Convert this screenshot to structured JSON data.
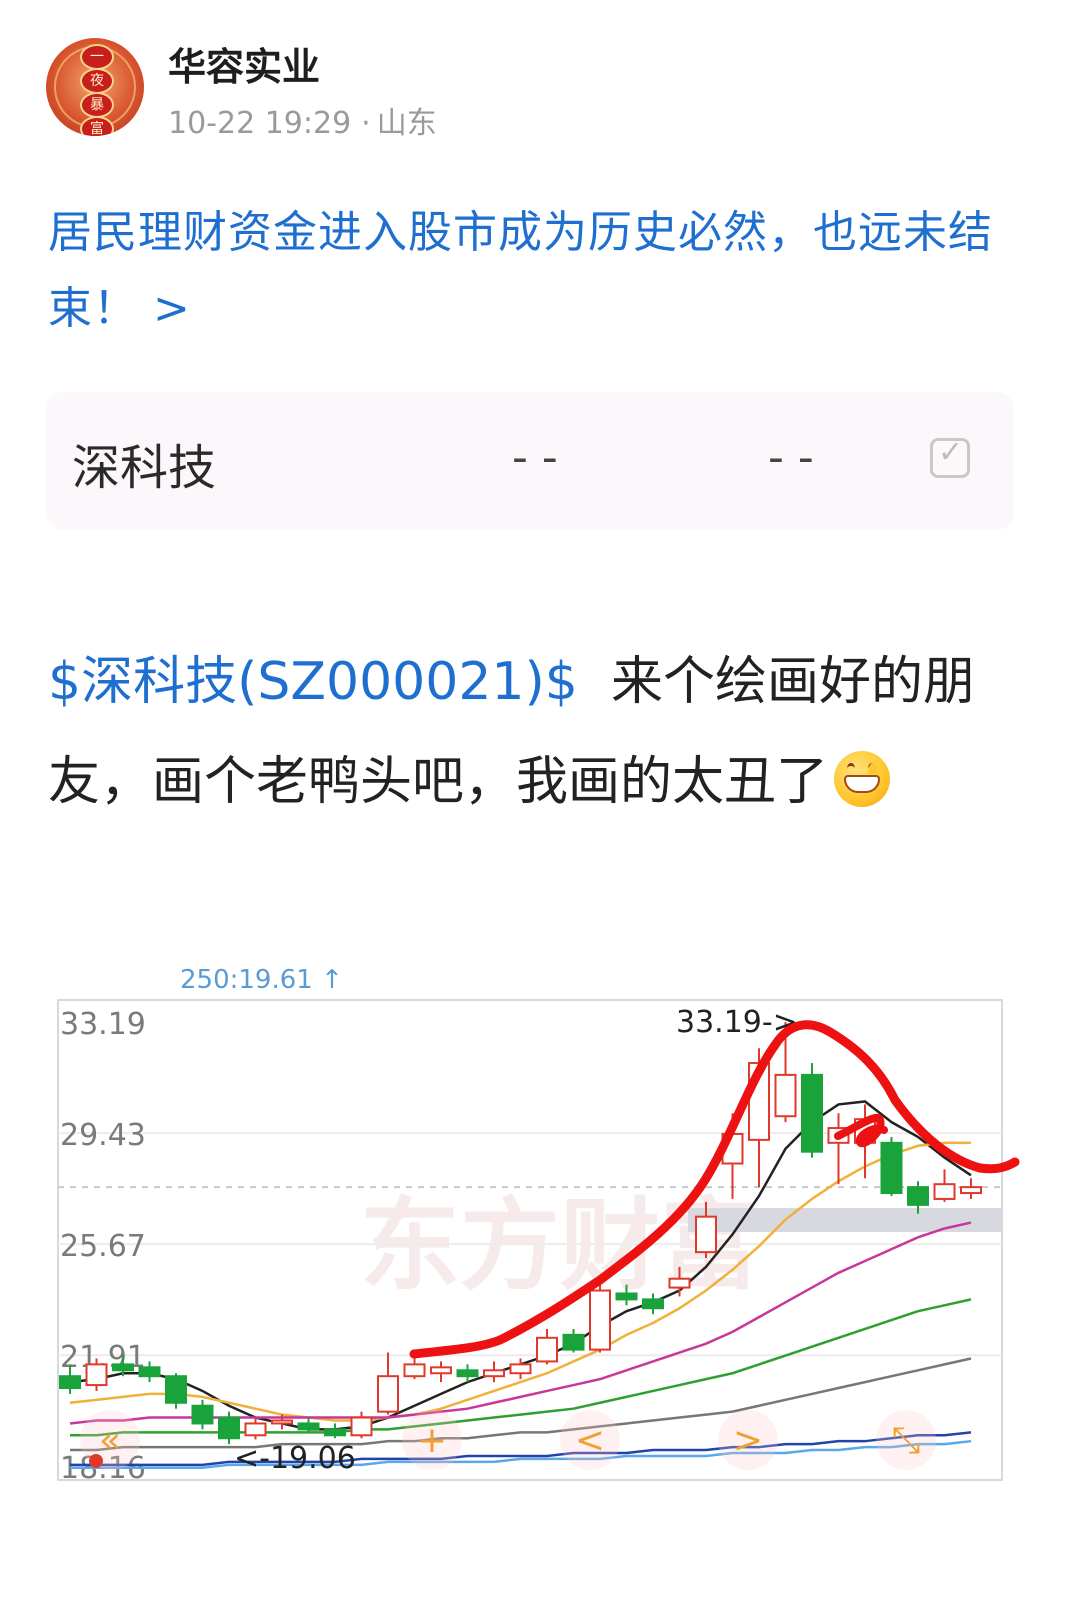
{
  "author": {
    "avatar_chars": [
      "一",
      "夜",
      "暴",
      "富"
    ],
    "name": "华容实业",
    "time": "10-22 19:29",
    "separator": "·",
    "location": "山东"
  },
  "headline": {
    "text": "居民理财资金进入股市成为历史必然，也远未结束！",
    "arrow": ">"
  },
  "stock_card": {
    "name": "深科技",
    "price": "--",
    "change": "--",
    "checkbox_icon": "check-icon"
  },
  "post": {
    "tag": "$深科技(SZ000021)$",
    "text": "来个绘画好的朋友，画个老鸭头吧，我画的太丑了",
    "emoji": "grinning-face-icon"
  },
  "chart": {
    "top_label": "250:19.61 ↑",
    "watermark": "东方财富",
    "high_label": "33.19->",
    "low_label": "<-19.06",
    "controls": [
      {
        "name": "rewind-icon",
        "glyph": "«"
      },
      {
        "name": "crosshair-icon",
        "glyph": "+"
      },
      {
        "name": "prev-icon",
        "glyph": "<"
      },
      {
        "name": "next-icon",
        "glyph": ">"
      },
      {
        "name": "expand-icon",
        "glyph": "⤡"
      }
    ],
    "colors": {
      "up": "#e0392b",
      "down": "#1aa33a",
      "annotation": "#ee1111"
    }
  },
  "chart_data": {
    "type": "candlestick",
    "y_ticks": [
      "33.19",
      "29.43",
      "25.67",
      "21.91",
      "18.16"
    ],
    "ylim": [
      18.16,
      33.19
    ],
    "grid": true,
    "candles": [
      {
        "o": 21.2,
        "c": 20.8,
        "h": 21.6,
        "l": 20.6
      },
      {
        "o": 20.9,
        "c": 21.6,
        "h": 21.8,
        "l": 20.7
      },
      {
        "o": 21.6,
        "c": 21.4,
        "h": 21.9,
        "l": 21.2
      },
      {
        "o": 21.5,
        "c": 21.2,
        "h": 21.7,
        "l": 21.0
      },
      {
        "o": 21.2,
        "c": 20.3,
        "h": 21.3,
        "l": 20.1
      },
      {
        "o": 20.2,
        "c": 19.6,
        "h": 20.4,
        "l": 19.4
      },
      {
        "o": 19.8,
        "c": 19.1,
        "h": 20.0,
        "l": 18.9
      },
      {
        "o": 19.2,
        "c": 19.6,
        "h": 19.8,
        "l": 19.06
      },
      {
        "o": 19.6,
        "c": 19.7,
        "h": 19.9,
        "l": 19.4
      },
      {
        "o": 19.6,
        "c": 19.4,
        "h": 19.8,
        "l": 19.3
      },
      {
        "o": 19.4,
        "c": 19.2,
        "h": 19.6,
        "l": 19.1
      },
      {
        "o": 19.2,
        "c": 19.8,
        "h": 20.0,
        "l": 19.1
      },
      {
        "o": 20.0,
        "c": 21.2,
        "h": 22.0,
        "l": 19.9
      },
      {
        "o": 21.2,
        "c": 21.6,
        "h": 21.9,
        "l": 21.1
      },
      {
        "o": 21.3,
        "c": 21.5,
        "h": 21.7,
        "l": 21.0
      },
      {
        "o": 21.4,
        "c": 21.2,
        "h": 21.6,
        "l": 21.0
      },
      {
        "o": 21.2,
        "c": 21.4,
        "h": 21.7,
        "l": 21.0
      },
      {
        "o": 21.3,
        "c": 21.6,
        "h": 21.8,
        "l": 21.1
      },
      {
        "o": 21.7,
        "c": 22.5,
        "h": 22.8,
        "l": 21.6
      },
      {
        "o": 22.6,
        "c": 22.1,
        "h": 22.8,
        "l": 22.0
      },
      {
        "o": 22.1,
        "c": 24.1,
        "h": 24.3,
        "l": 22.0
      },
      {
        "o": 24.0,
        "c": 23.8,
        "h": 24.3,
        "l": 23.6
      },
      {
        "o": 23.8,
        "c": 23.5,
        "h": 24.0,
        "l": 23.3
      },
      {
        "o": 24.2,
        "c": 24.5,
        "h": 24.9,
        "l": 23.9
      },
      {
        "o": 25.4,
        "c": 26.6,
        "h": 27.1,
        "l": 25.2
      },
      {
        "o": 28.4,
        "c": 29.4,
        "h": 30.1,
        "l": 27.2
      },
      {
        "o": 29.2,
        "c": 31.8,
        "h": 32.3,
        "l": 27.6
      },
      {
        "o": 30.0,
        "c": 31.4,
        "h": 33.19,
        "l": 29.8
      },
      {
        "o": 31.4,
        "c": 28.8,
        "h": 31.8,
        "l": 28.6
      },
      {
        "o": 29.1,
        "c": 29.6,
        "h": 30.1,
        "l": 27.7
      },
      {
        "o": 29.1,
        "c": 29.9,
        "h": 30.4,
        "l": 27.9
      },
      {
        "o": 29.1,
        "c": 27.4,
        "h": 29.3,
        "l": 27.3
      },
      {
        "o": 27.6,
        "c": 27.0,
        "h": 27.8,
        "l": 26.7
      },
      {
        "o": 27.2,
        "c": 27.7,
        "h": 28.2,
        "l": 27.1
      },
      {
        "o": 27.4,
        "c": 27.6,
        "h": 27.9,
        "l": 27.2
      }
    ],
    "ma_series": [
      {
        "color": "#222222",
        "values": [
          21.0,
          21.1,
          21.3,
          21.3,
          21.1,
          20.7,
          20.2,
          19.8,
          19.6,
          19.4,
          19.4,
          19.5,
          19.8,
          20.2,
          20.6,
          21.0,
          21.3,
          21.6,
          21.9,
          22.3,
          22.9,
          23.4,
          23.7,
          24.1,
          24.9,
          26.0,
          27.3,
          28.9,
          29.8,
          30.4,
          30.5,
          29.8,
          29.3,
          28.6,
          28.0
        ]
      },
      {
        "color": "#f0b13a",
        "values": [
          20.3,
          20.4,
          20.5,
          20.6,
          20.6,
          20.5,
          20.3,
          20.1,
          19.9,
          19.8,
          19.7,
          19.7,
          19.8,
          19.9,
          20.1,
          20.4,
          20.7,
          21.0,
          21.3,
          21.7,
          22.1,
          22.6,
          23.0,
          23.5,
          24.1,
          24.8,
          25.6,
          26.5,
          27.2,
          27.8,
          28.3,
          28.7,
          29.0,
          29.1,
          29.1
        ]
      },
      {
        "color": "#c8379a",
        "values": [
          19.6,
          19.7,
          19.7,
          19.8,
          19.8,
          19.8,
          19.8,
          19.8,
          19.8,
          19.8,
          19.8,
          19.8,
          19.8,
          19.9,
          20.0,
          20.1,
          20.3,
          20.5,
          20.7,
          20.9,
          21.1,
          21.4,
          21.7,
          22.0,
          22.3,
          22.7,
          23.2,
          23.7,
          24.2,
          24.7,
          25.1,
          25.5,
          25.9,
          26.2,
          26.4
        ]
      },
      {
        "color": "#2ea02e",
        "values": [
          19.2,
          19.2,
          19.3,
          19.3,
          19.3,
          19.3,
          19.3,
          19.3,
          19.3,
          19.3,
          19.3,
          19.4,
          19.4,
          19.5,
          19.6,
          19.7,
          19.8,
          19.9,
          20.0,
          20.1,
          20.3,
          20.5,
          20.7,
          20.9,
          21.1,
          21.3,
          21.6,
          21.9,
          22.2,
          22.5,
          22.8,
          23.1,
          23.4,
          23.6,
          23.8
        ]
      },
      {
        "color": "#777777",
        "values": [
          18.7,
          18.7,
          18.8,
          18.8,
          18.8,
          18.8,
          18.8,
          18.8,
          18.9,
          18.9,
          18.9,
          18.9,
          19.0,
          19.0,
          19.1,
          19.1,
          19.2,
          19.3,
          19.3,
          19.4,
          19.5,
          19.6,
          19.7,
          19.8,
          19.9,
          20.0,
          20.2,
          20.4,
          20.6,
          20.8,
          21.0,
          21.2,
          21.4,
          21.6,
          21.8
        ]
      },
      {
        "color": "#2244aa",
        "values": [
          18.2,
          18.2,
          18.2,
          18.2,
          18.2,
          18.2,
          18.3,
          18.3,
          18.3,
          18.3,
          18.3,
          18.4,
          18.4,
          18.4,
          18.4,
          18.5,
          18.5,
          18.5,
          18.5,
          18.6,
          18.6,
          18.6,
          18.7,
          18.7,
          18.7,
          18.8,
          18.8,
          18.9,
          18.9,
          19.0,
          19.0,
          19.1,
          19.2,
          19.2,
          19.3
        ]
      },
      {
        "color": "#5aa8e8",
        "values": [
          18.1,
          18.1,
          18.1,
          18.1,
          18.1,
          18.1,
          18.2,
          18.2,
          18.2,
          18.2,
          18.2,
          18.2,
          18.3,
          18.3,
          18.3,
          18.3,
          18.3,
          18.4,
          18.4,
          18.4,
          18.4,
          18.5,
          18.5,
          18.5,
          18.5,
          18.6,
          18.6,
          18.6,
          18.7,
          18.7,
          18.8,
          18.8,
          18.9,
          18.9,
          19.0
        ]
      }
    ]
  }
}
